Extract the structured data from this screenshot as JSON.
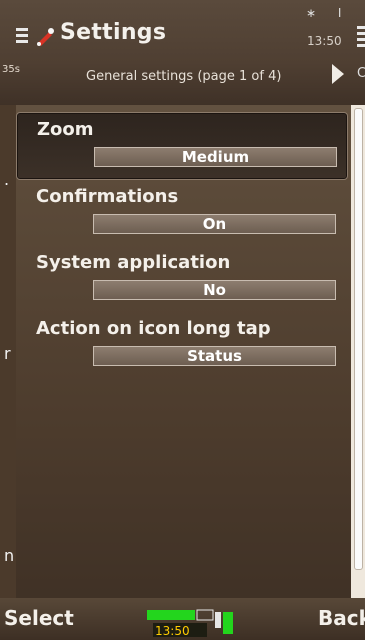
{
  "app": {
    "title": "Settings",
    "clock": "13:50",
    "page_label": "General settings (page 1 of 4)",
    "left_stub_text": "35s",
    "right_stub_text": "C"
  },
  "settings": [
    {
      "label": "Zoom",
      "value": "Medium",
      "selected": true
    },
    {
      "label": "Confirmations",
      "value": "On",
      "selected": false
    },
    {
      "label": "System application",
      "value": "No",
      "selected": false
    },
    {
      "label": "Action on icon long tap",
      "value": "Status",
      "selected": false
    }
  ],
  "left_bleed": [
    ".",
    "r",
    "n"
  ],
  "softkeys": {
    "left": "Select",
    "right": "Back"
  },
  "indicator": {
    "time": "13:50"
  },
  "colors": {
    "accent_green": "#23d51d",
    "title_icon_red": "#d83325"
  }
}
